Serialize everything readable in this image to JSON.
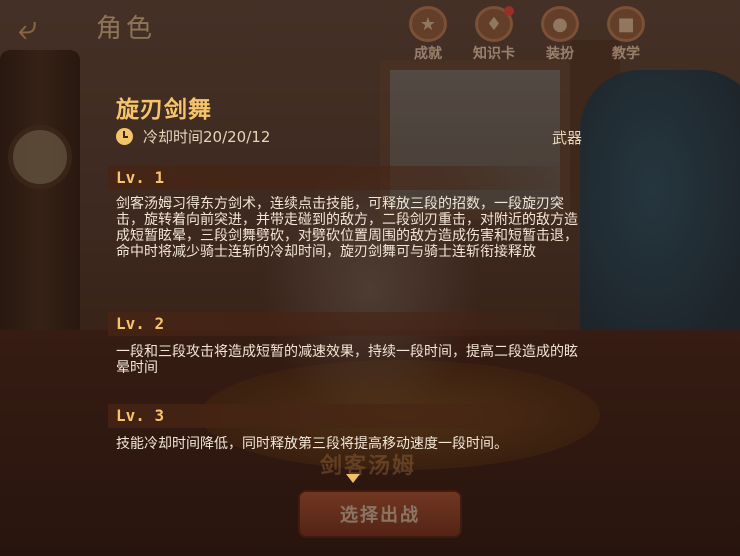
{
  "header": {
    "back_icon": "back-arrow-icon",
    "title": "角色",
    "nav": [
      {
        "label": "成就",
        "icon": "trophy-icon",
        "badge": false
      },
      {
        "label": "知识卡",
        "icon": "card-icon",
        "badge": true
      },
      {
        "label": "装扮",
        "icon": "outfit-icon",
        "badge": false
      },
      {
        "label": "教学",
        "icon": "book-icon",
        "badge": false
      }
    ]
  },
  "skill": {
    "name": "旋刃剑舞",
    "cooldown": "冷却时间20/20/12",
    "category": "武器",
    "levels": [
      {
        "label": "Lv. 1",
        "desc": "剑客汤姆习得东方剑术，连续点击技能，可释放三段的招数，一段旋刃突击，旋转着向前突进，并带走碰到的敌方，二段剑刃重击，对附近的敌方造成短暂眩晕，三段剑舞劈砍，对劈砍位置周围的敌方造成伤害和短暂击退，命中时将减少骑士连斩的冷却时间，旋刃剑舞可与骑士连斩衔接释放"
      },
      {
        "label": "Lv. 2",
        "desc": "一段和三段攻击将造成短暂的减速效果，持续一段时间，提高二段造成的眩晕时间"
      },
      {
        "label": "Lv. 3",
        "desc": "技能冷却时间降低，同时释放第三段将提高移动速度一段时间。"
      }
    ]
  },
  "bottom": {
    "banner": "剑客汤姆",
    "select_label": "选择出战"
  },
  "colors": {
    "accent_gold": "#f6c46c",
    "text_light": "#f2e6d6",
    "badge_red": "#ff3030"
  }
}
